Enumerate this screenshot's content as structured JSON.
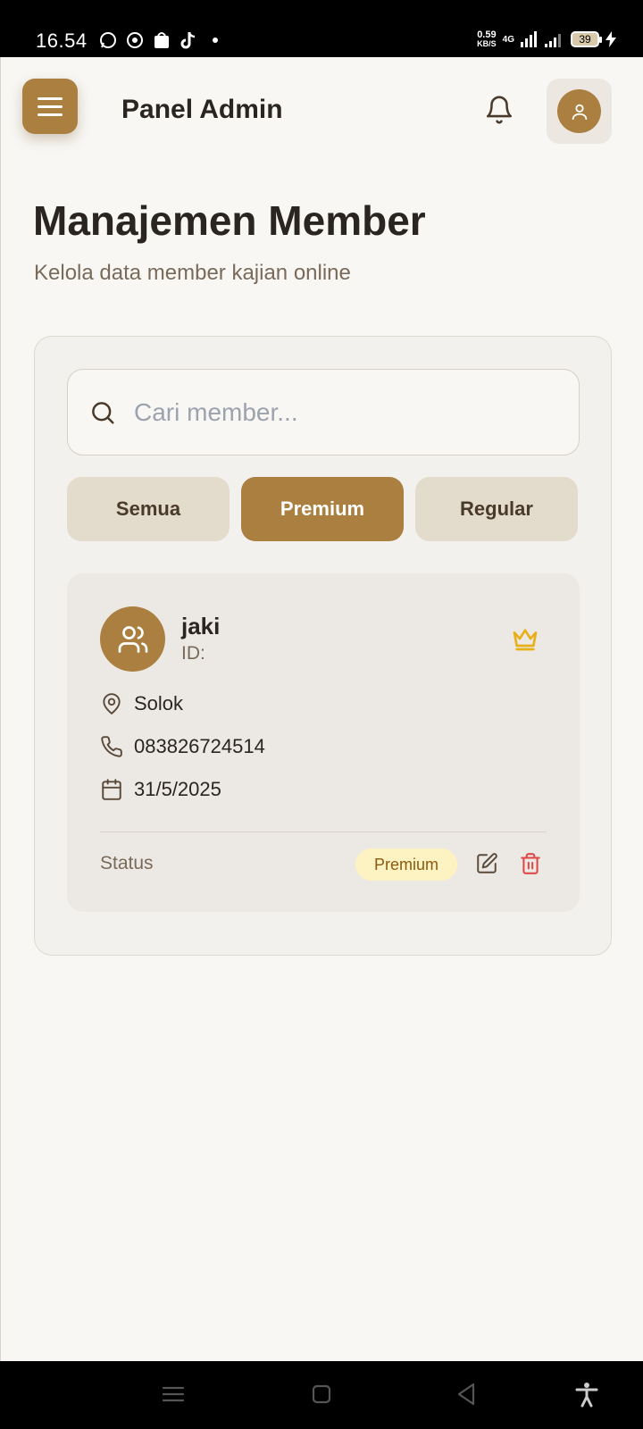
{
  "status_bar": {
    "time": "16.54",
    "net_speed_value": "0.59",
    "net_speed_unit": "KB/S",
    "network": "4G",
    "battery": "39"
  },
  "header": {
    "title": "Panel Admin"
  },
  "page": {
    "title": "Manajemen Member",
    "subtitle": "Kelola data member kajian online"
  },
  "search": {
    "placeholder": "Cari member...",
    "value": ""
  },
  "filters": [
    {
      "label": "Semua",
      "active": false
    },
    {
      "label": "Premium",
      "active": true
    },
    {
      "label": "Regular",
      "active": false
    }
  ],
  "member": {
    "name": "jaki",
    "id_label": "ID:",
    "location": "Solok",
    "phone": "083826724514",
    "date": "31/5/2025",
    "status_label": "Status",
    "status_badge": "Premium"
  },
  "colors": {
    "accent": "#ab7f40",
    "background": "#f8f7f4",
    "danger": "#e04848",
    "crown": "#e8b017"
  },
  "icons": {
    "menu": "hamburger-icon",
    "notification": "bell-icon",
    "profile": "user-icon",
    "search": "search-icon",
    "member_avatar": "users-icon",
    "premium": "crown-icon",
    "location": "map-pin-icon",
    "phone": "phone-icon",
    "date": "calendar-icon",
    "edit": "edit-icon",
    "delete": "trash-icon"
  }
}
